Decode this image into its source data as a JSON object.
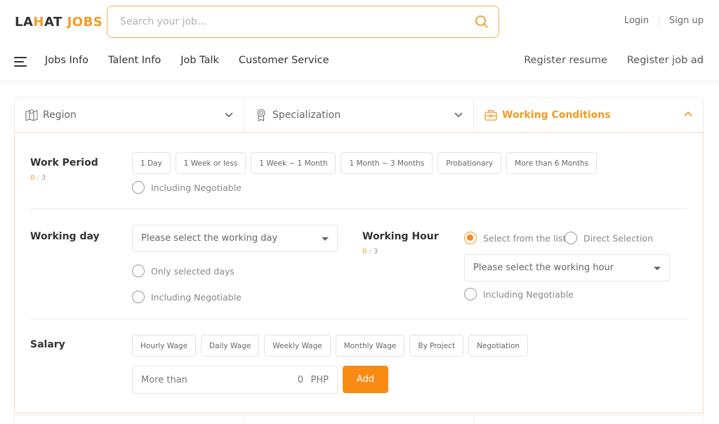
{
  "header": {
    "logo": {
      "part1": "LA",
      "part2": "H",
      "part3": "AT",
      "part4": "JOBS"
    },
    "search": {
      "placeholder": "Search your job...",
      "value": ""
    },
    "auth": {
      "login": "Login",
      "signup": "Sign up"
    }
  },
  "nav": {
    "left": [
      "Jobs Info",
      "Talent Info",
      "Job Talk",
      "Customer Service"
    ],
    "right": [
      "Register resume",
      "Register job ad"
    ]
  },
  "filter_tabs": [
    {
      "label": "Region",
      "icon": "map-pin-icon",
      "expanded": false
    },
    {
      "label": "Specialization",
      "icon": "award-icon",
      "expanded": false
    },
    {
      "label": "Working Conditions",
      "icon": "briefcase-icon",
      "expanded": true
    }
  ],
  "work_period": {
    "label": "Work Period",
    "count_current": "0",
    "count_max": "3",
    "options": [
      "1 Day",
      "1 Week or less",
      "1 Week ~ 1 Month",
      "1 Month ~ 3 Months",
      "Probationary",
      "More than 6 Months"
    ],
    "negotiable_label": "Including Negotiable"
  },
  "working_day": {
    "label": "Working day",
    "select_placeholder": "Please select the working day",
    "only_selected_label": "Only selected days",
    "negotiable_label": "Including Negotiable"
  },
  "working_hour": {
    "label": "Working Hour",
    "count_current": "0",
    "count_max": "3",
    "mode_list_label": "Select from the list",
    "mode_direct_label": "Direct Selection",
    "selected_mode": "list",
    "select_placeholder": "Please select the working hour",
    "negotiable_label": "Including Negotiable"
  },
  "salary": {
    "label": "Salary",
    "options": [
      "Hourly Wage",
      "Daily Wage",
      "Weekly Wage",
      "Monthly Wage",
      "By Project",
      "Negotiation"
    ],
    "prefix": "More than",
    "amount": "0",
    "currency": "PHP",
    "add_label": "Add"
  },
  "colors": {
    "accent": "#f39a26",
    "button": "#f98b14",
    "panel_border": "#fbd9b5"
  }
}
